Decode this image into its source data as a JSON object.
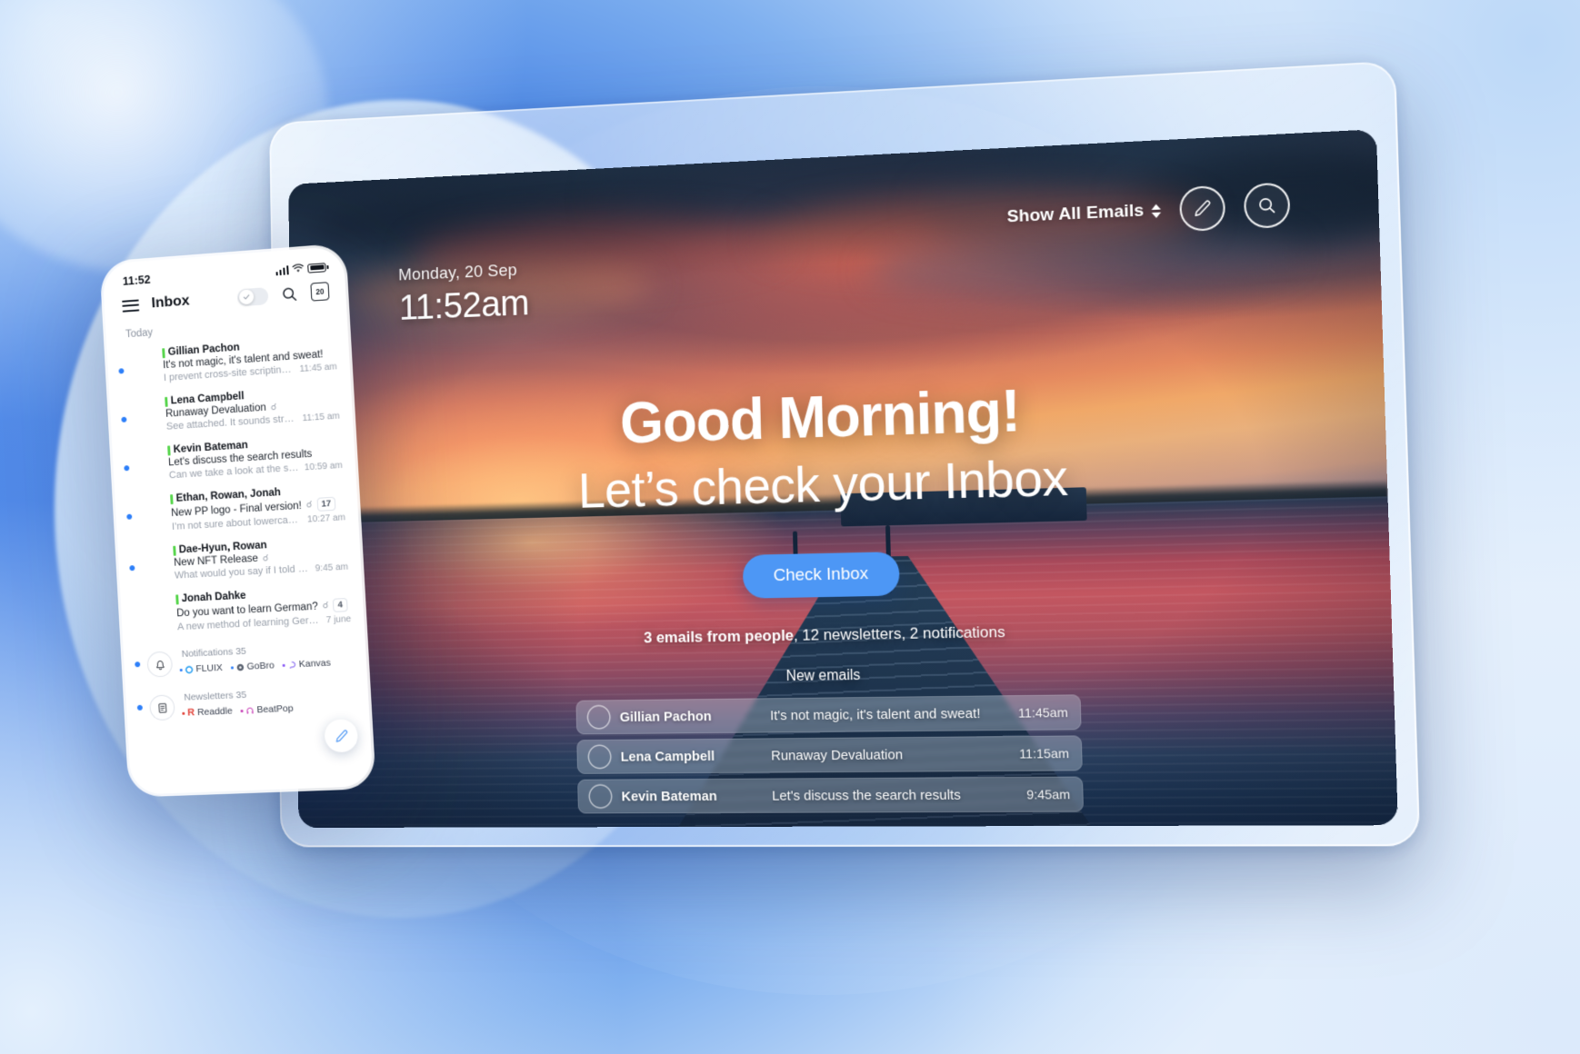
{
  "colors": {
    "accent_blue": "#4d97f5",
    "unread_dot": "#2d7ff9",
    "sender_bar_green": "#5ad64f",
    "phone_text": "#11151c",
    "muted": "#9aa1ac"
  },
  "tablet": {
    "date": "Monday, 20 Sep",
    "time": "11:52am",
    "filter_label": "Show All Emails",
    "compose_icon": "pencil-icon",
    "search_icon": "search-icon",
    "greeting_line1": "Good Morning!",
    "greeting_line2": "Let’s check your Inbox",
    "cta_label": "Check Inbox",
    "counts": {
      "people": "3 emails from people",
      "rest": ", 12 newsletters, 2 notifications"
    },
    "new_emails_label": "New emails",
    "emails": [
      {
        "name": "Gillian Pachon",
        "subject": "It's not magic, it's talent and sweat!",
        "time": "11:45am"
      },
      {
        "name": "Lena Campbell",
        "subject": "Runaway Devaluation",
        "time": "11:15am"
      },
      {
        "name": "Kevin Bateman",
        "subject": "Let's discuss the search results",
        "time": "9:45am"
      }
    ]
  },
  "phone": {
    "status_time": "11:52",
    "status_icons": [
      "signal-bars-icon",
      "wifi-icon",
      "battery-icon"
    ],
    "menu_icon": "hamburger-menu-icon",
    "title": "Inbox",
    "toggle_icon": "check-toggle",
    "search_icon": "search-icon",
    "calendar_icon": "calendar-icon",
    "calendar_day": "20",
    "section_label": "Today",
    "mails": [
      {
        "sender": "Gillian Pachon",
        "subject": "It's not magic, it's talent and sweat!",
        "snippet": "I prevent cross-site scripting...",
        "time": "11:45 am",
        "unread": true,
        "attachment": false,
        "count": ""
      },
      {
        "sender": "Lena Campbell",
        "subject": "Runaway Devaluation",
        "snippet": "See attached. It sounds strange...",
        "time": "11:15 am",
        "unread": true,
        "attachment": true,
        "count": ""
      },
      {
        "sender": "Kevin Bateman",
        "subject": "Let's discuss the search results",
        "snippet": "Can we take a look at the search...",
        "time": "10:59 am",
        "unread": true,
        "attachment": false,
        "count": ""
      },
      {
        "sender": "Ethan, Rowan, Jonah",
        "subject": "New PP logo - Final version!",
        "snippet": "I’m not sure about lowercase...",
        "time": "10:27 am",
        "unread": true,
        "attachment": true,
        "count": "17"
      },
      {
        "sender": "Dae-Hyun, Rowan",
        "subject": "New NFT Release",
        "snippet": "What would you say if I told you ...",
        "time": "9:45 am",
        "unread": true,
        "attachment": true,
        "count": ""
      },
      {
        "sender": "Jonah Dahke",
        "subject": "Do you want to learn German?",
        "snippet": "A new method of learning German",
        "time": "7 june",
        "unread": false,
        "attachment": true,
        "count": "4"
      }
    ],
    "groups": [
      {
        "icon": "bell-icon",
        "title": "Notifications",
        "count": "35",
        "sources": [
          "FLUIX",
          "GoBro",
          "Kanvas"
        ]
      },
      {
        "icon": "newsletter-icon",
        "title": "Newsletters",
        "count": "35",
        "sources": [
          "Readdle",
          "BeatPop"
        ]
      }
    ],
    "fab_icon": "compose-pencil-icon"
  }
}
